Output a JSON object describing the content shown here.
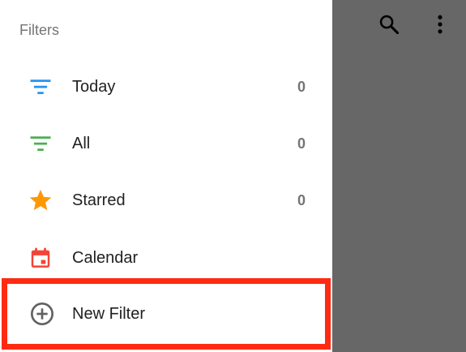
{
  "drawer": {
    "section_title": "Filters",
    "items": [
      {
        "label": "Today",
        "count": "0",
        "icon": "filter-list-icon",
        "color": "#2196f3"
      },
      {
        "label": "All",
        "count": "0",
        "icon": "filter-list-icon",
        "color": "#4caf50"
      },
      {
        "label": "Starred",
        "count": "0",
        "icon": "star-icon",
        "color": "#ff9800"
      },
      {
        "label": "Calendar",
        "icon": "calendar-icon",
        "color": "#f44336"
      },
      {
        "label": "New Filter",
        "icon": "add-circle-outline-icon",
        "color": "#616161"
      }
    ],
    "highlight_color": "#ff2a12"
  },
  "toolbar": {
    "icons": [
      "search-icon",
      "more-vert-icon"
    ]
  },
  "colors": {
    "scrim": "#676767",
    "drawer_background": "#ffffff"
  }
}
